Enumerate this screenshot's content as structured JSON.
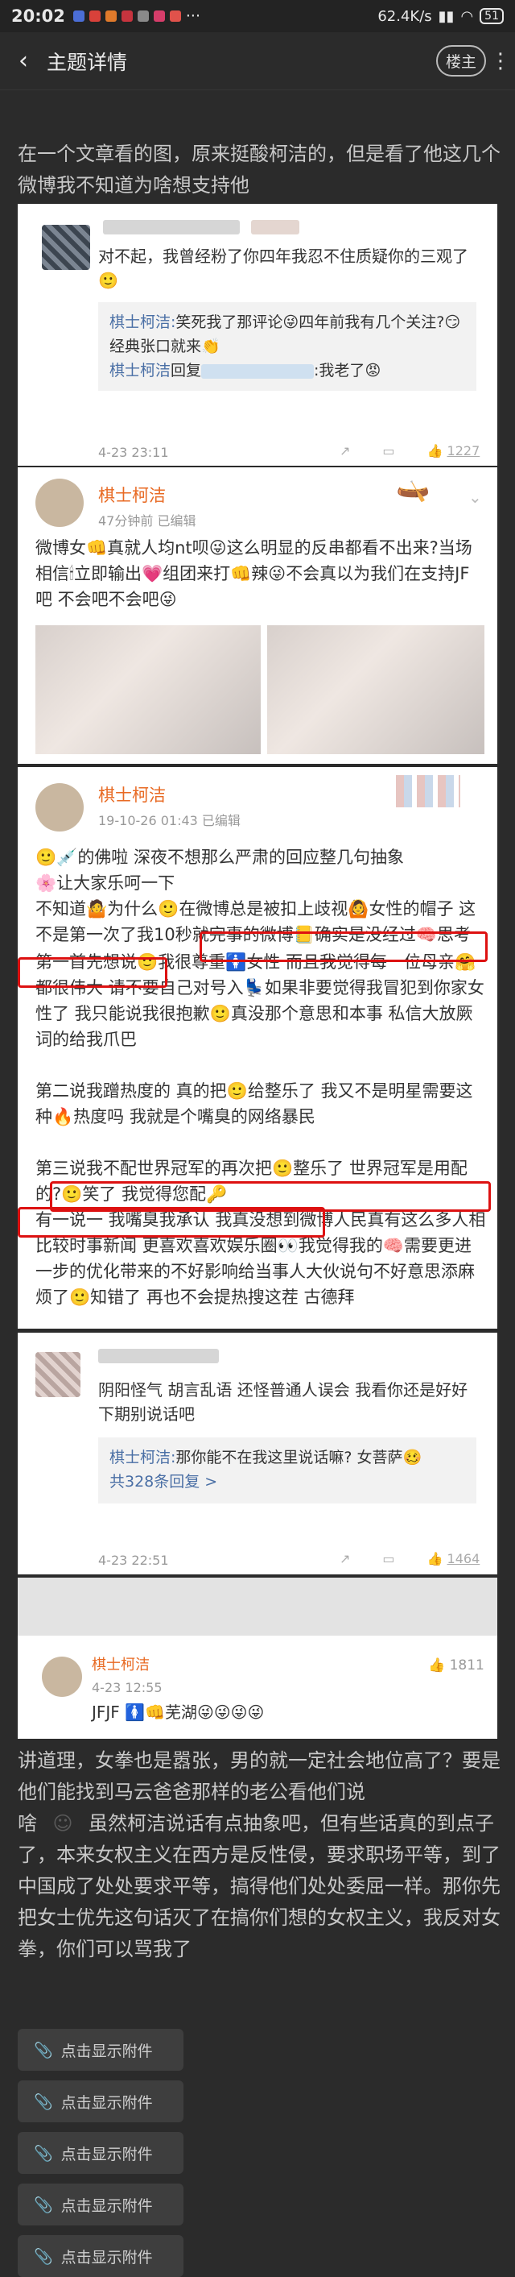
{
  "status": {
    "time": "20:02",
    "network": "62.4K/s",
    "battery": "51"
  },
  "nav": {
    "title": "主题详情",
    "owner_label": "楼主",
    "back_icon": "chevron-left-icon",
    "more_icon": "more-vertical-icon"
  },
  "post": {
    "intro": "在一个文章看的图，原来挺酸柯洁的，但是看了他这几个微博我不知道为啥想支持他",
    "outro_1": "讲道理，女拳也是嚣张，男的就一定社会地位高了？要是他们能找到马云爸爸那样的老公看他们说",
    "outro_2": "啥",
    "outro_3": "虽然柯洁说话有点抽象吧，但有些话真的到点子了，本来女权主义在西方是反性侵，要求职场平等，到了中国成了处处要求平等，搞得他们处处委屈一样。那你先把女士优先这句话灭了在搞你们想的女权主义，我反对女拳，你们可以骂我了"
  },
  "card1": {
    "comment": "对不起，我曾经粉了你四年我忍不住质疑你的三观了",
    "reply1_name": "棋士柯洁:",
    "reply1_text": "笑死我了那评论",
    "reply1_text2": "四年前我有几个关注?",
    "reply1_text3": "经典张口就来",
    "reply2_name": "棋士柯洁",
    "reply2_mid": "回复",
    "reply2_text": ":我老了",
    "time": "4-23 23:11",
    "likes": "1227"
  },
  "card2": {
    "name": "棋士柯洁",
    "meta": "47分钟前",
    "edited": "已编辑",
    "body1": "微博女",
    "body2": "真就人均nt呗",
    "body3": "这么明显的反串都看不出来?",
    "body4": "当场相信",
    "body5": "立即输出",
    "body6": "组团来打",
    "body7": "辣",
    "body8": "不会真以为我们在支持JF吧 不会吧不会吧"
  },
  "card3": {
    "name": "棋士柯洁",
    "meta": "19-10-26 01:43",
    "edited": "已编辑",
    "p1": "的佛啦  深夜不想那么严肃的回应整几句抽象",
    "p1b": "让大家乐呵一下",
    "p2a": "不知道",
    "p2b": "为什么",
    "p2c": "在微博总是被扣上歧视",
    "p2d": "女性的帽子  这不是第一次了",
    "p2e": "我10秒就完事的微博",
    "p2f": "确实是没经过",
    "p2g": "思考",
    "p3": "第一首先想说",
    "p3b": "我很尊重",
    "p3c": "女性  而且我觉得每一位母亲",
    "p3d": "都很伟大  请不要自己对号入",
    "p3e": "如果非要觉得我冒犯到你家女性了  我只能说我很抱歉",
    "p3f": "真没那个意思和本事  私信大放厥词的给我爪巴",
    "p4": "第二说我蹭热度的  真的把",
    "p4b": "给整乐了  我又不是明星需要这种",
    "p4c": "热度吗  我就是个嘴臭的网络暴民",
    "p5": "第三说我不配世界冠军的再次把",
    "p5b": "整乐了  世界冠军是用配的?",
    "p5c": "笑了  我觉得您配",
    "p6": "有一说一  我嘴臭我承认  我真没想到微博人民真有这么多人相比较时事新闻  更喜欢喜欢娱乐圈",
    "p6b": "我觉得我的",
    "p6c": "需要更进一步的优化",
    "p6d": "带来的不好影响给当事人大伙说句不好意思添麻烦了",
    "p6e": "知错了  再也不会提热搜这茬  古德拜"
  },
  "card4": {
    "comment": "阴阳怪气  胡言乱语  还怪普通人误会  我看你还是好好下期别说话吧",
    "reply_name": "棋士柯洁:",
    "reply_text": "那你能不在我这里说话嘛? 女菩萨",
    "reply_count": "共328条回复 >",
    "time": "4-23 22:51",
    "likes": "1464"
  },
  "card5": {
    "name": "棋士柯洁",
    "time": "4-23 12:55",
    "likes": "1811",
    "body": "JFJF",
    "body2": "芜湖"
  },
  "attachments": [
    {
      "label": "点击显示附件"
    },
    {
      "label": "点击显示附件"
    },
    {
      "label": "点击显示附件"
    },
    {
      "label": "点击显示附件"
    },
    {
      "label": "点击显示附件"
    }
  ],
  "colors": {
    "bg": "#2b2b2b",
    "card": "#ffffff",
    "name_orange": "#e86a23",
    "highlight_red": "#dd1111",
    "link_blue": "#4a6fa5"
  }
}
